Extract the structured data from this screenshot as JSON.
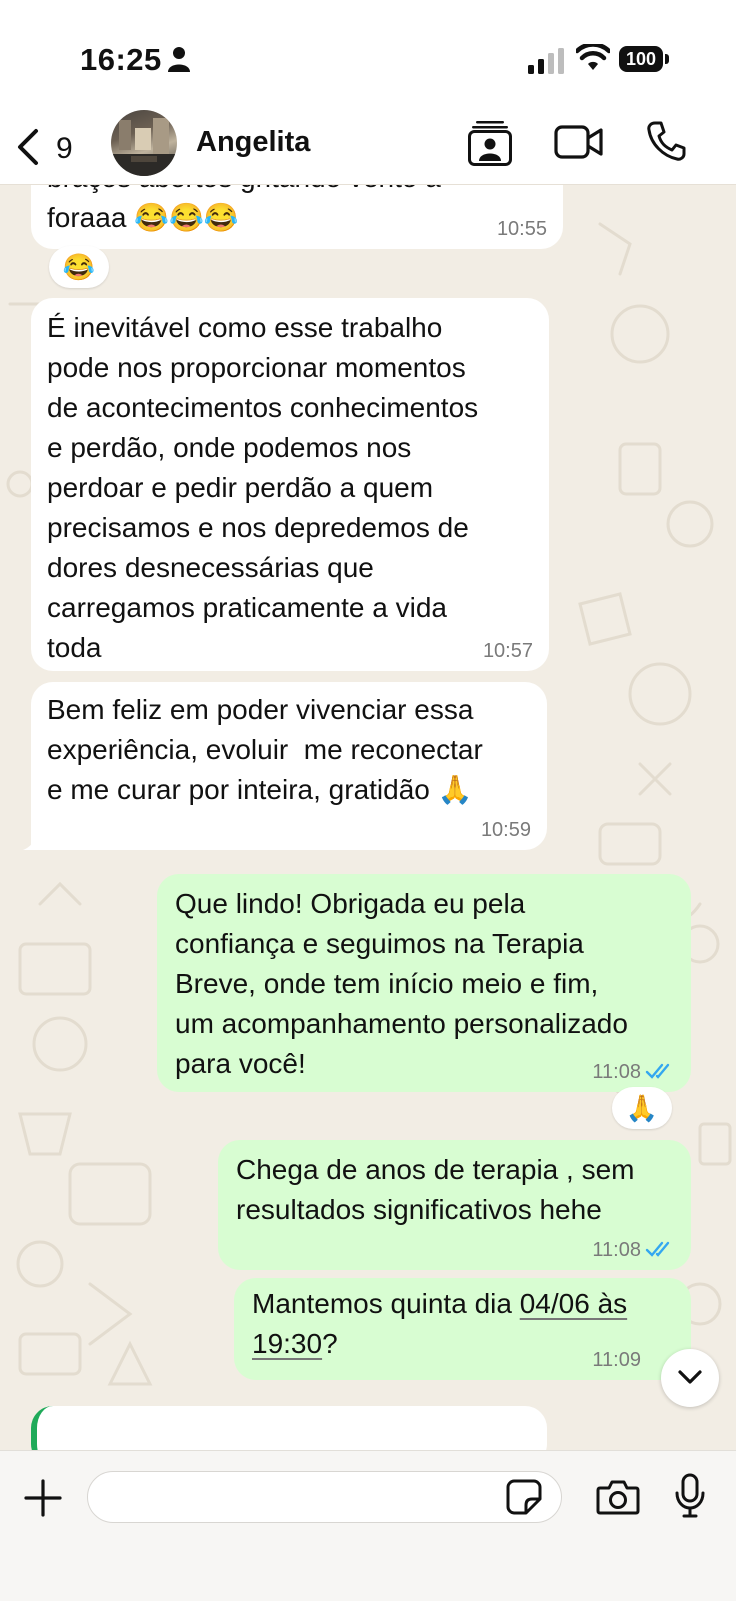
{
  "status_bar": {
    "time": "16:25",
    "battery": "100"
  },
  "header": {
    "back_count": "9",
    "contact_name": "Angelita"
  },
  "messages": [
    {
      "id": "m1",
      "direction": "in",
      "text": "braços abertos gritando vento a\nforaaa 😂😂😂",
      "time": "10:55",
      "reaction": "😂"
    },
    {
      "id": "m2",
      "direction": "in",
      "text": "É inevitável como esse trabalho\npode nos proporcionar momentos\nde acontecimentos conhecimentos\ne perdão, onde podemos nos\nperdoar e pedir perdão a quem\nprecisamos e nos depredemos de\ndores desnecessárias que\ncarregamos praticamente a vida\ntoda",
      "time": "10:57"
    },
    {
      "id": "m3",
      "direction": "in",
      "text": "Bem feliz em poder vivenciar essa\nexperiência, evoluir  me reconectar\ne me curar por inteira, gratidão 🙏",
      "time": "10:59"
    },
    {
      "id": "m4",
      "direction": "out",
      "text": "Que lindo! Obrigada eu pela\nconfiança e seguimos na Terapia\nBreve, onde tem início meio e fim,\num acompanhamento personalizado\npara você!",
      "time": "11:08",
      "reaction": "🙏"
    },
    {
      "id": "m5",
      "direction": "out",
      "text": "Chega de anos de terapia , sem\nresultados significativos hehe",
      "time": "11:08"
    },
    {
      "id": "m6",
      "direction": "out",
      "text_before": "Mantemos quinta dia ",
      "text_link1": "04/06 às",
      "text_mid": "\n",
      "text_link2": "19:30",
      "text_after": "?",
      "time": "11:09"
    }
  ],
  "input": {
    "placeholder": ""
  },
  "colors": {
    "outgoing_bubble": "#d8fdd2",
    "incoming_bubble": "#ffffff",
    "read_ticks": "#34a7f0",
    "wallpaper": "#f2ede4"
  },
  "icons": [
    "person-icon",
    "signal-icon",
    "wifi-icon",
    "back-chevron-icon",
    "contact-card-icon",
    "video-call-icon",
    "phone-icon",
    "chevron-down-icon",
    "plus-icon",
    "sticker-icon",
    "camera-icon",
    "microphone-icon"
  ]
}
